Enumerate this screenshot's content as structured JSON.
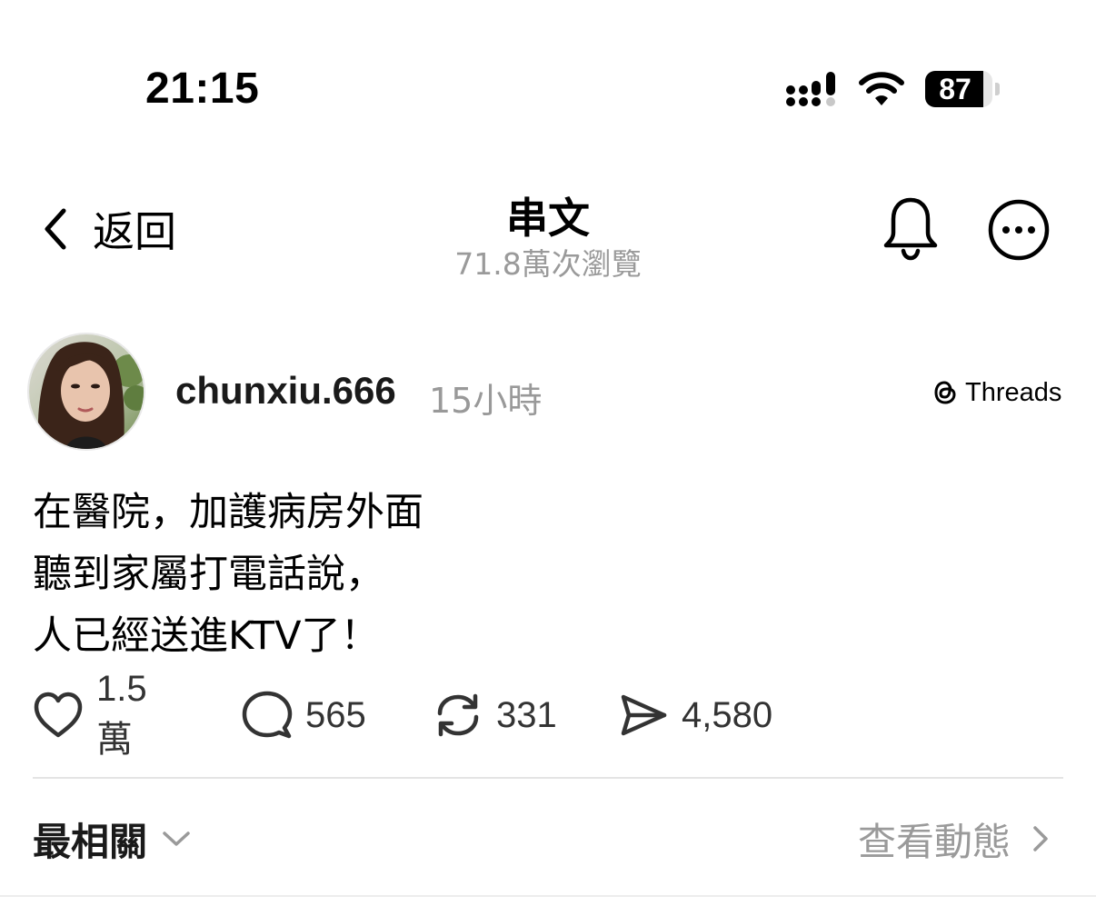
{
  "status_bar": {
    "time": "21:15",
    "battery_level": "87",
    "battery_fraction": 0.87,
    "icons": [
      "signal-icon",
      "wifi-icon",
      "battery-icon"
    ]
  },
  "nav": {
    "back_label": "返回",
    "title": "串文",
    "subtitle": "71.8萬次瀏覽",
    "icons": [
      "chevron-left-icon",
      "bell-icon",
      "more-icon"
    ]
  },
  "post": {
    "username": "chunxiu.666",
    "time_ago": "15小時",
    "source_label": "Threads",
    "lines": [
      "在醫院，加護病房外面",
      "聽到家屬打電話說，",
      "人已經送進KTV了！"
    ],
    "actions": {
      "likes": "1.5萬",
      "comments": "565",
      "reposts": "331",
      "shares": "4,580"
    }
  },
  "footer": {
    "sort_label": "最相關",
    "activity_label": "查看動態"
  }
}
